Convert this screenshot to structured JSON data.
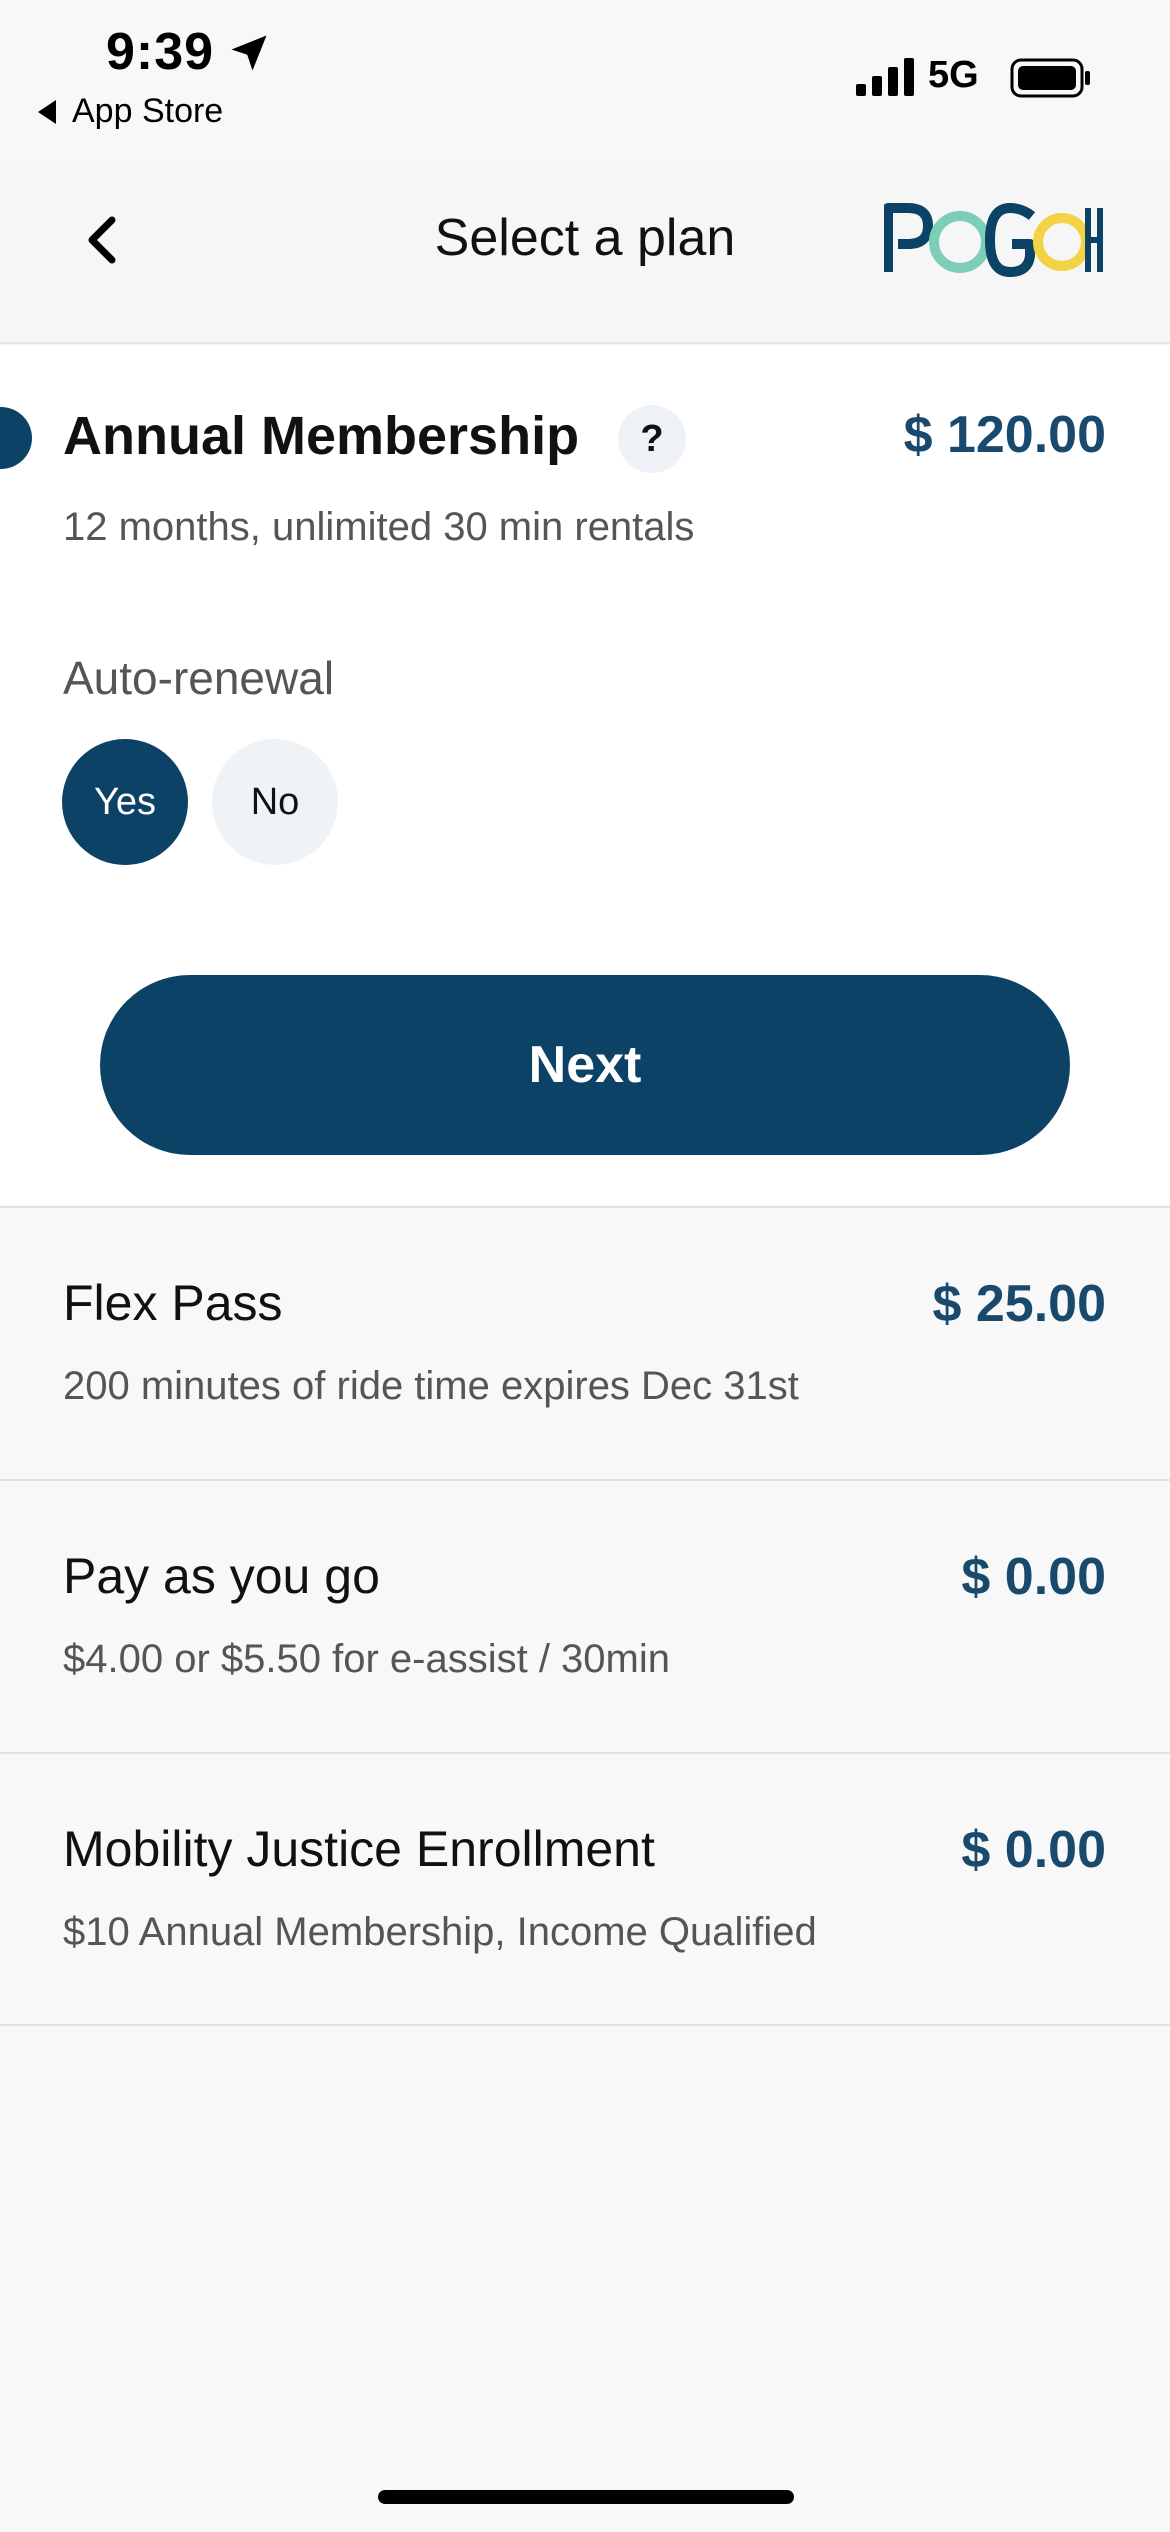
{
  "status_bar": {
    "time": "9:39",
    "back_app": "App Store",
    "network": "5G"
  },
  "header": {
    "title": "Select a plan",
    "logo_text": "POGOH"
  },
  "selected_plan": {
    "name": "Annual Membership",
    "help": "?",
    "price": "$ 120.00",
    "description": "12 months, unlimited 30 min rentals",
    "auto_renewal_label": "Auto-renewal",
    "auto_renewal_options": [
      "Yes",
      "No"
    ],
    "auto_renewal_selected": "Yes",
    "next_label": "Next"
  },
  "plans": [
    {
      "name": "Flex Pass",
      "price": "$ 25.00",
      "description": "200 minutes of ride time expires Dec 31st"
    },
    {
      "name": "Pay as you go",
      "price": "$ 0.00",
      "description": "$4.00 or $5.50 for e-assist / 30min"
    },
    {
      "name": "Mobility Justice Enrollment",
      "price": "$ 0.00",
      "description": "$10 Annual Membership, Income Qualified"
    }
  ],
  "colors": {
    "primary": "#0d4267",
    "price": "#194a6e",
    "logo_teal": "#7ccfb6",
    "logo_yellow": "#f2d343"
  }
}
